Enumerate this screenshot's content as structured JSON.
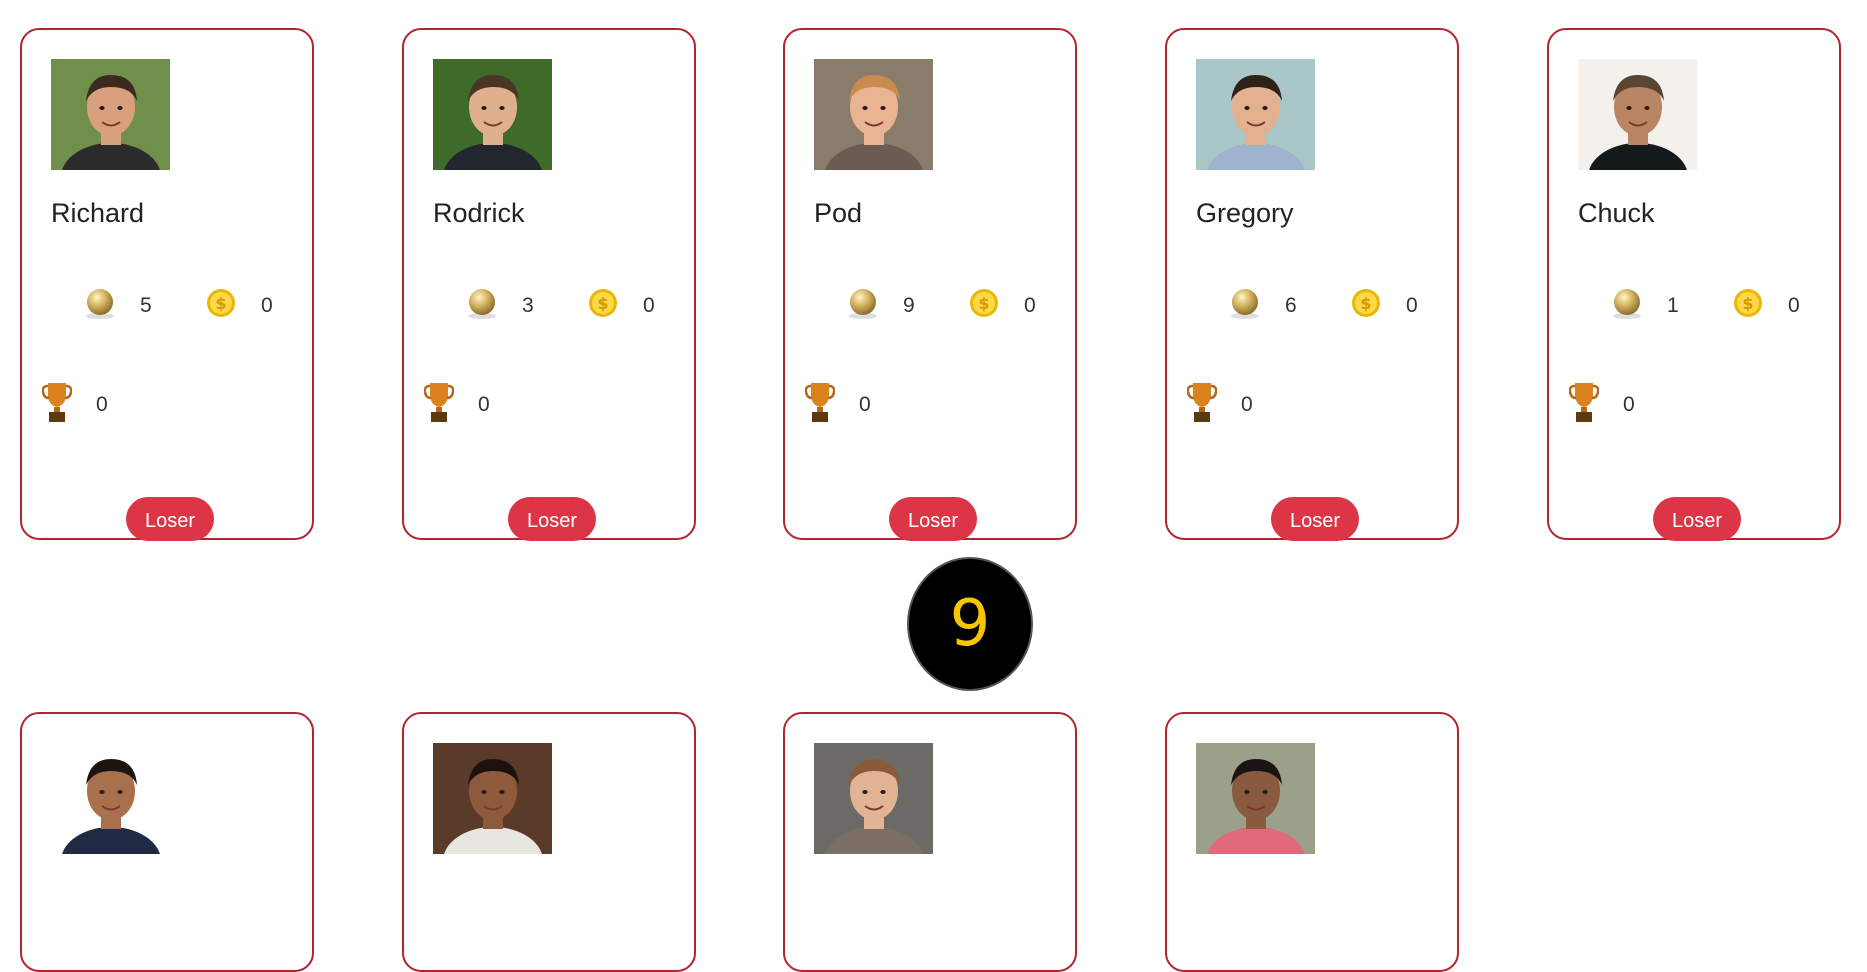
{
  "players_top": [
    {
      "name": "Richard",
      "balls": "5",
      "coins": "0",
      "trophies": "0",
      "button": "Loser",
      "avatar": {
        "bg": "#6f8f4a",
        "skin": "#d9a07e",
        "hair": "#3b2a1f",
        "shirt": "#2b2b2b"
      }
    },
    {
      "name": "Rodrick",
      "balls": "3",
      "coins": "0",
      "trophies": "0",
      "button": "Loser",
      "avatar": {
        "bg": "#3f6b2a",
        "skin": "#e0b08e",
        "hair": "#4a3526",
        "shirt": "#22262e"
      }
    },
    {
      "name": "Pod",
      "balls": "9",
      "coins": "0",
      "trophies": "0",
      "button": "Loser",
      "avatar": {
        "bg": "#8a7c6a",
        "skin": "#e8b494",
        "hair": "#c98c4e",
        "shirt": "#6b5b52"
      }
    },
    {
      "name": "Gregory",
      "balls": "6",
      "coins": "0",
      "trophies": "0",
      "button": "Loser",
      "avatar": {
        "bg": "#a9c7c9",
        "skin": "#e3b190",
        "hair": "#2e2219",
        "shirt": "#9fb3cc"
      }
    },
    {
      "name": "Chuck",
      "balls": "1",
      "coins": "0",
      "trophies": "0",
      "button": "Loser",
      "avatar": {
        "bg": "#f4f1ec",
        "skin": "#b98563",
        "hair": "#5a4433",
        "shirt": "#141a1c"
      }
    }
  ],
  "players_bottom": [
    {
      "avatar": {
        "bg": "#ffffff",
        "skin": "#a8704c",
        "hair": "#1c1410",
        "shirt": "#1f2a44"
      }
    },
    {
      "avatar": {
        "bg": "#5a3b2a",
        "skin": "#8d5a3c",
        "hair": "#1b1210",
        "shirt": "#e8e6e1"
      }
    },
    {
      "avatar": {
        "bg": "#6b6a66",
        "skin": "#e2b395",
        "hair": "#8a5b3a",
        "shirt": "#7a6f62"
      }
    },
    {
      "avatar": {
        "bg": "#9aa08a",
        "skin": "#8a5a3e",
        "hair": "#1a1412",
        "shirt": "#e06a7a"
      }
    }
  ],
  "timer": {
    "value": "9"
  },
  "colors": {
    "card_border": "#b0262e",
    "button_bg": "#dc3545",
    "timer_bg": "#000000",
    "timer_text": "#f7c600"
  },
  "icons": {
    "ball": "gold-ball-icon",
    "coin": "gold-coin-icon",
    "trophy": "trophy-icon"
  }
}
